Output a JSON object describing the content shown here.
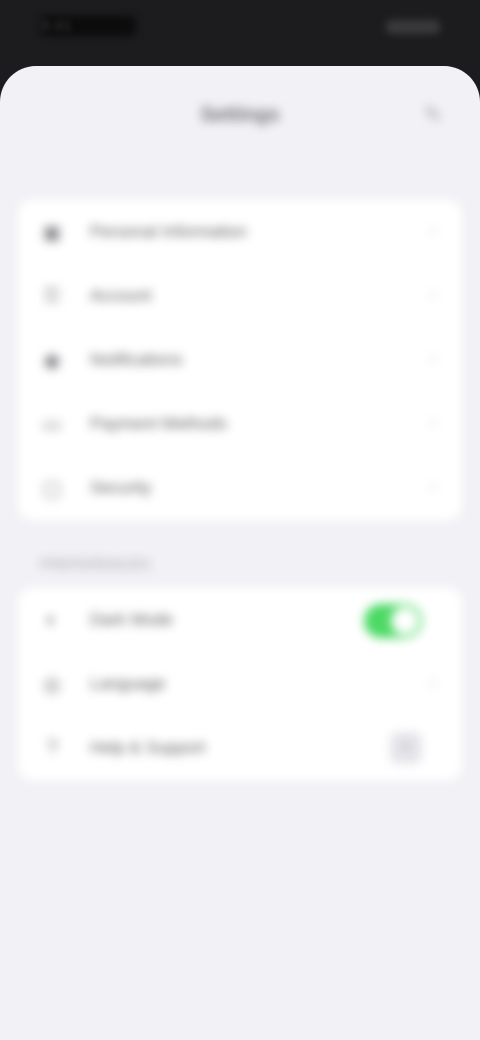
{
  "status_bar": {
    "time": "9:41"
  },
  "sheet": {
    "title": "Settings",
    "action_icon": "edit-icon"
  },
  "groups": {
    "first": [
      {
        "label": "Personal Information",
        "icon": "person-card-icon"
      },
      {
        "label": "Account",
        "icon": "key-icon"
      },
      {
        "label": "Notifications",
        "icon": "bell-icon"
      },
      {
        "label": "Payment Methods",
        "icon": "card-icon"
      },
      {
        "label": "Security",
        "icon": "lock-icon"
      }
    ],
    "section_header": "PREFERENCES",
    "second": [
      {
        "label": "Dark Mode",
        "icon": "moon-icon",
        "toggle_on": true
      },
      {
        "label": "Language",
        "icon": "globe-icon"
      },
      {
        "label": "Help & Support",
        "icon": "help-icon",
        "trailing": "plus-icon"
      }
    ]
  },
  "colors": {
    "toggle_on": "#4cd964",
    "sheet_bg": "#f2f2f6",
    "row_bg": "#ffffff"
  }
}
